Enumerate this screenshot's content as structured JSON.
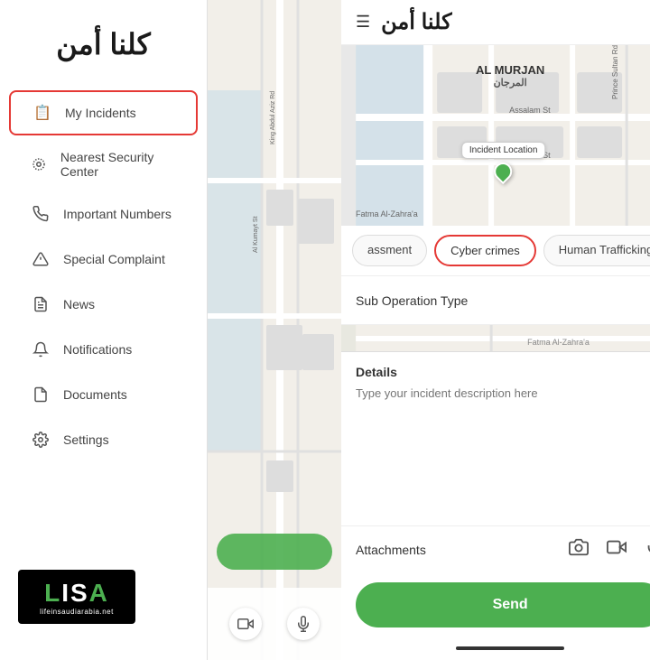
{
  "sidebar": {
    "logo": "كلنا أمن",
    "items": [
      {
        "id": "my-incidents",
        "label": "My Incidents",
        "icon": "📋",
        "active": true
      },
      {
        "id": "nearest-security",
        "label": "Nearest Security Center",
        "icon": "📍",
        "active": false
      },
      {
        "id": "important-numbers",
        "label": "Important Numbers",
        "icon": "📞",
        "active": false
      },
      {
        "id": "special-complaint",
        "label": "Special Complaint",
        "icon": "⚠️",
        "active": false
      },
      {
        "id": "news",
        "label": "News",
        "icon": "📰",
        "active": false
      },
      {
        "id": "notifications",
        "label": "Notifications",
        "icon": "🔔",
        "active": false
      },
      {
        "id": "documents",
        "label": "Documents",
        "icon": "📄",
        "active": false
      },
      {
        "id": "settings",
        "label": "Settings",
        "icon": "⚙️",
        "active": false
      }
    ],
    "lisa": {
      "letters": "LISA",
      "sub": "lifeinsaudiarabia.net"
    }
  },
  "right_panel": {
    "header": {
      "hamburger": "☰",
      "logo": "كلنا أمن"
    },
    "map": {
      "label": "AL MURJAN",
      "label_ar": "المرجان",
      "incident_location": "Incident Location"
    },
    "tabs": [
      {
        "id": "harassment",
        "label": "assment",
        "active": false
      },
      {
        "id": "cyber-crimes",
        "label": "Cyber crimes",
        "active": true
      },
      {
        "id": "human-trafficking",
        "label": "Human Trafficking",
        "active": false
      }
    ],
    "sub_operation": {
      "label": "Sub Operation Type",
      "chevron": "⌄"
    },
    "details": {
      "label": "Details",
      "placeholder": "Type your incident description here"
    },
    "attachments": {
      "label": "Attachments",
      "camera_icon": "📷",
      "video_icon": "🎥",
      "mic_icon": "🎤"
    },
    "send_button": "Send"
  },
  "map_panel": {
    "bottom_icons": [
      "📷",
      "🎤"
    ]
  }
}
